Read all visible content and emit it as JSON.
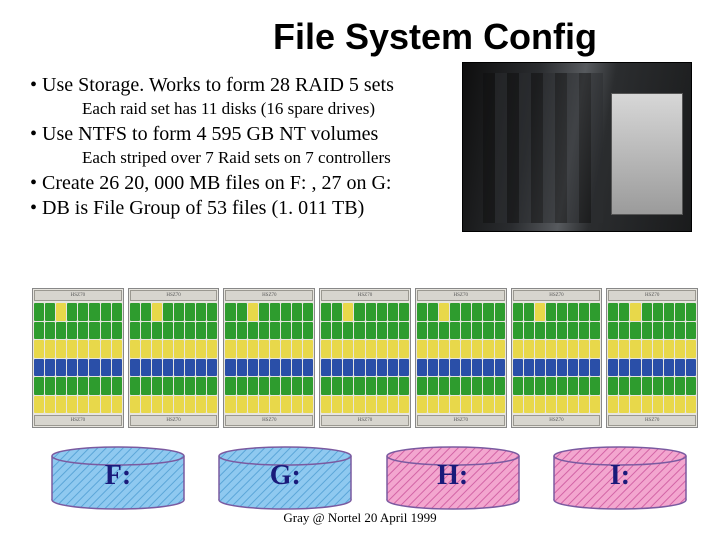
{
  "title": "File System Config",
  "bullets": [
    {
      "text": "Use Storage. Works to form 28 RAID 5 sets",
      "sub": "Each raid set has 11 disks (16 spare drives)"
    },
    {
      "text": "Use NTFS to form  4  595 GB NT volumes",
      "sub": "Each striped over 7 Raid sets on 7 controllers"
    },
    {
      "text": "Create 26 20, 000 MB files on F: , 27 on G:",
      "sub": null
    },
    {
      "text": "DB is File Group of 53 files (1. 011 TB)",
      "sub": null
    }
  ],
  "rack_header": "HSZ70",
  "rack_footer": "HSZ70",
  "rack_count": 7,
  "cylinders": [
    {
      "label": "F:",
      "fill": "#8fc9f0",
      "hatch": "#5aa5d8"
    },
    {
      "label": "G:",
      "fill": "#8fc9f0",
      "hatch": "#5aa5d8"
    },
    {
      "label": "H:",
      "fill": "#f3a6cf",
      "hatch": "#d263a5"
    },
    {
      "label": "I:",
      "fill": "#f3a6cf",
      "hatch": "#d263a5"
    }
  ],
  "footer": "Gray @ Nortel 20 April 1999"
}
